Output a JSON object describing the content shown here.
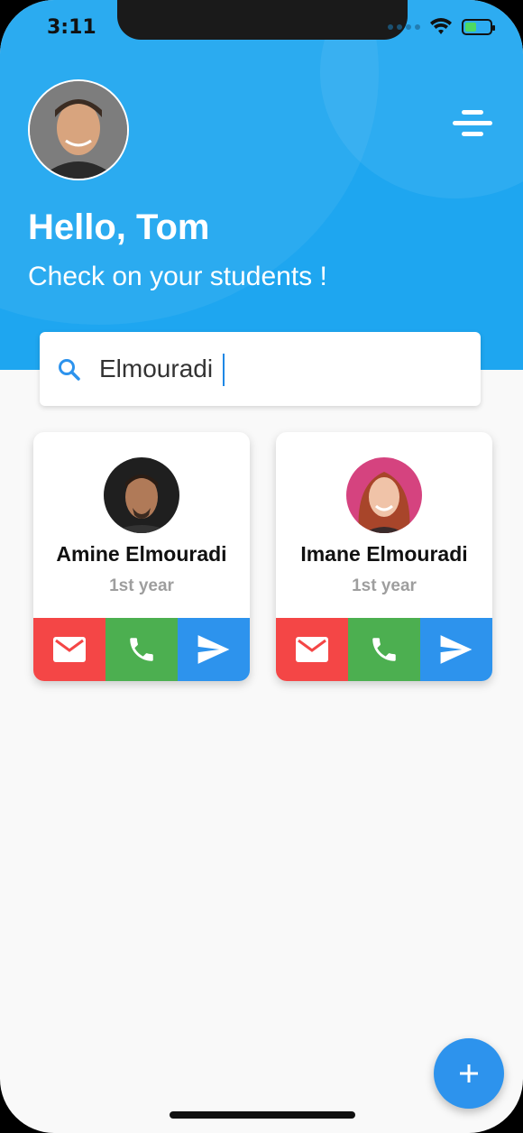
{
  "status_bar": {
    "time": "3:11"
  },
  "header": {
    "greeting": "Hello, Tom",
    "subtitle": "Check on your students !"
  },
  "search": {
    "value": "Elmouradi",
    "placeholder": ""
  },
  "students": [
    {
      "name": "Amine Elmouradi",
      "year": "1st year"
    },
    {
      "name": "Imane Elmouradi",
      "year": "1st year"
    }
  ],
  "icons": {
    "menu": "menu-icon",
    "search": "search-icon",
    "mail": "mail-icon",
    "phone": "phone-icon",
    "send": "send-icon",
    "add": "plus-icon"
  },
  "colors": {
    "header": "#1ea6f0",
    "mail": "#f44646",
    "call": "#4caf50",
    "send": "#2d93ed",
    "fab": "#2d93ed"
  }
}
